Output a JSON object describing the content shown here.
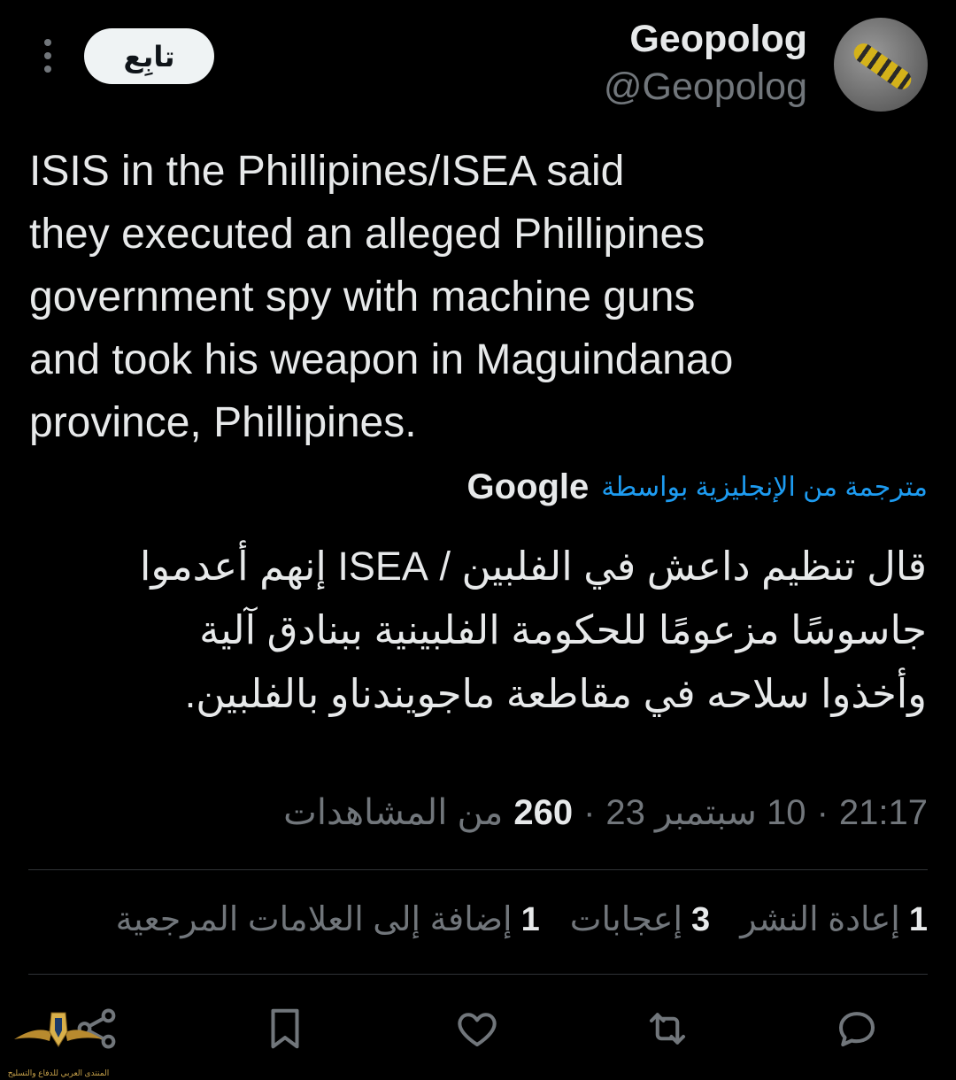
{
  "author": {
    "name": "Geopolog",
    "handle": "@Geopolog",
    "avatar_icon": "caterpillar-avatar"
  },
  "follow_label": "تابِع",
  "tweet": {
    "text": "ISIS in the Phillipines/ISEA said\nthey executed an alleged Phillipines\ngovernment spy with machine guns\nand took his weapon in Maguindanao\nprovince, Phillipines.",
    "translated_label": "مترجمة من الإنجليزية بواسطة",
    "translator": "Google",
    "translation": "قال تنظيم داعش في الفلبين / ISEA إنهم أعدموا\nجاسوسًا مزعومًا للحكومة الفلبينية ببنادق آلية\nوأخذوا سلاحه في مقاطعة ماجويندناو بالفلبين."
  },
  "meta": {
    "time": "21:17",
    "date": "10 سبتمبر 23",
    "views_count": "260",
    "views_label": "من المشاهدات"
  },
  "stats": {
    "retweets_count": "1",
    "retweets_label": "إعادة النشر",
    "likes_count": "3",
    "likes_label": "إعجابات",
    "bookmarks_count": "1",
    "bookmarks_label": "إضافة إلى العلامات المرجعية"
  },
  "actions": [
    "reply-icon",
    "retweet-icon",
    "like-icon",
    "bookmark-icon",
    "share-icon"
  ],
  "watermark": {
    "text": "المنتدى العربي للدفاع والتسليح"
  },
  "colors": {
    "background": "#000000",
    "text": "#e7e9ea",
    "muted": "#71767b",
    "link": "#1d9bf0",
    "divider": "#2f3336"
  }
}
